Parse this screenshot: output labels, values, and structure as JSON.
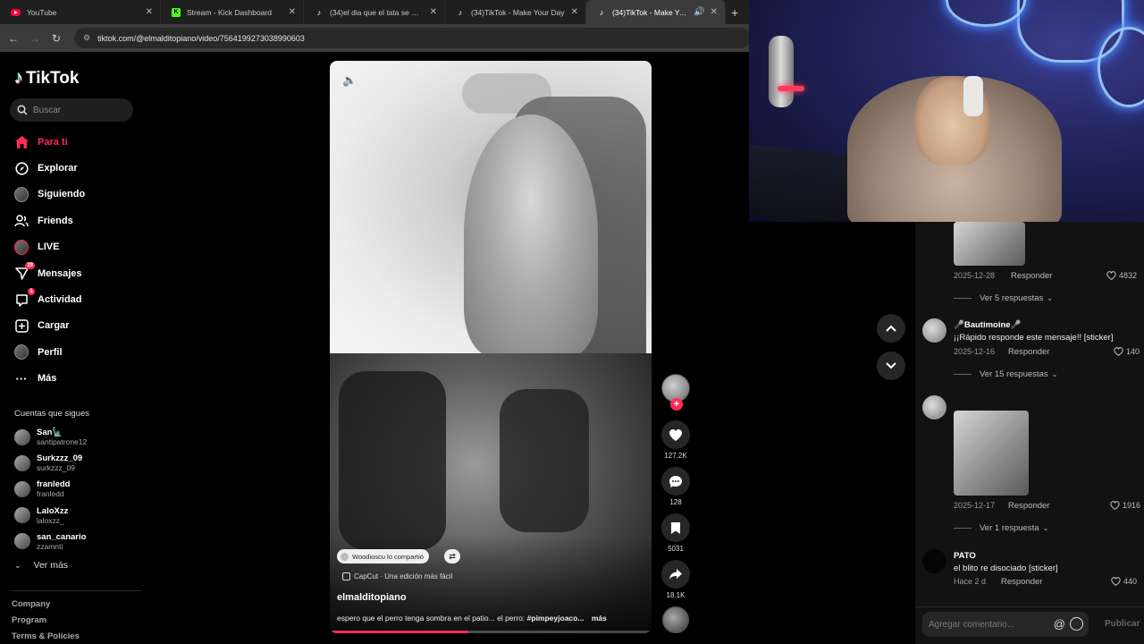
{
  "browser": {
    "tabs": [
      {
        "icon": "youtube-favicon",
        "label": "YouTube",
        "active": false
      },
      {
        "icon": "kick-favicon",
        "label": "Stream - Kick Dashboard",
        "active": false
      },
      {
        "icon": "tiktok-favicon",
        "label": "(34)el dia que el tata se mato s...",
        "active": false
      },
      {
        "icon": "tiktok-favicon",
        "label": "(34)TikTok - Make Your Day",
        "active": false
      },
      {
        "icon": "tiktok-favicon",
        "label": "(34)TikTok - Make Your Day",
        "active": true
      }
    ],
    "url": "tiktok.com/@elmalditopiano/video/7564199273038990603"
  },
  "sidebar": {
    "logo": "TikTok",
    "search_placeholder": "Buscar",
    "nav": [
      {
        "label": "Para ti",
        "icon": "home-icon",
        "active": true
      },
      {
        "label": "Explorar",
        "icon": "compass-icon"
      },
      {
        "label": "Siguiendo",
        "icon": "avatar-icon"
      },
      {
        "label": "Friends",
        "icon": "friends-icon"
      },
      {
        "label": "LIVE",
        "icon": "live-avatar-icon"
      },
      {
        "label": "Mensajes",
        "icon": "send-icon",
        "badge": "29"
      },
      {
        "label": "Actividad",
        "icon": "inbox-icon",
        "badge": "1"
      },
      {
        "label": "Cargar",
        "icon": "upload-plus-icon"
      },
      {
        "label": "Perfil",
        "icon": "profile-avatar-icon"
      },
      {
        "label": "Más",
        "icon": "more-dots-icon"
      }
    ],
    "following_header": "Cuentas que sigues",
    "following": [
      {
        "name": "San🗽",
        "user": "santipatrone12"
      },
      {
        "name": "Surkzzz_09",
        "user": "surkzzz_09"
      },
      {
        "name": "franledd",
        "user": "franledd"
      },
      {
        "name": "LaloXzz",
        "user": "laloxzz_"
      },
      {
        "name": "san_canario",
        "user": "zzamnti"
      }
    ],
    "see_more": "Ver más",
    "footer": [
      "Company",
      "Program",
      "Terms & Policies"
    ]
  },
  "video": {
    "repost_text": "Woodioscu lo compartió",
    "capcut_text": "CapCut · Una edición más fácil",
    "author": "elmalditopiano",
    "description": "espero que el perro tenga sombra en el patio... el perro:",
    "hashtag": "#pimpeyjoaco...",
    "more": "más",
    "progress": 0.43
  },
  "actions": {
    "likes": "127.2K",
    "comments": "128",
    "saves": "5031",
    "shares": "18.1K"
  },
  "comments": {
    "items": [
      {
        "date": "2025-12-28",
        "reply": "Responder",
        "likes": "4832",
        "view_replies": "Ver 5 respuestas"
      },
      {
        "name": "🎤Bautimoine🎤",
        "text": "¡¡Rápido responde este mensaje!! [sticker]",
        "date": "2025-12-16",
        "reply": "Responder",
        "likes": "140",
        "view_replies": "Ver 15 respuestas"
      },
      {
        "date": "2025-12-17",
        "reply": "Responder",
        "likes": "1916",
        "view_replies": "Ver 1 respuesta"
      },
      {
        "name": "PATO",
        "text": "el blito re disociado [sticker]",
        "date": "Hace 2 d",
        "reply": "Responder",
        "likes": "440"
      }
    ],
    "input_placeholder": "Agregar comentario...",
    "publish": "Publicar"
  },
  "colors": {
    "accent": "#fe2c55",
    "bg": "#000000",
    "panel": "#121212"
  }
}
